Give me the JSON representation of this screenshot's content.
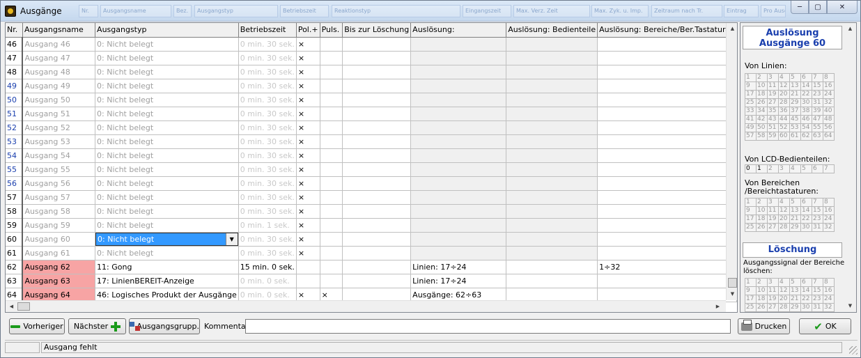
{
  "window": {
    "title": "Ausgänge",
    "ghost_toolbar": [
      "Nr.",
      "Ausgangsname",
      "Bez.",
      "Ausgangstyp",
      "Betriebszeit",
      "Reaktionstyp",
      "Eingangszeit",
      "Max. Verz. Zeit",
      "Max. Zyk. u. Imp.",
      "Zeitraum nach Tr.",
      "Eintrag",
      "Pro Ausgang"
    ]
  },
  "grid": {
    "columns": [
      "Nr.",
      "Ausgangsname",
      "Ausgangstyp",
      "Betriebszeit",
      "Pol.+",
      "Puls.",
      "Bis zur Löschung",
      "Auslösung:",
      "Auslösung: Bedienteile",
      "Auslösung: Bereiche/Ber.Tastaturen"
    ],
    "rows": [
      {
        "nr": "46",
        "name": "Ausgang 46",
        "type": "0: Nicht belegt",
        "time": "0 min. 30 sek.",
        "pol": "×",
        "puls": "",
        "bis": "",
        "ausl": "",
        "bed": "",
        "ber": ""
      },
      {
        "nr": "47",
        "name": "Ausgang 47",
        "type": "0: Nicht belegt",
        "time": "0 min. 30 sek.",
        "pol": "×",
        "puls": "",
        "bis": "",
        "ausl": "",
        "bed": "",
        "ber": ""
      },
      {
        "nr": "48",
        "name": "Ausgang 48",
        "type": "0: Nicht belegt",
        "time": "0 min. 30 sek.",
        "pol": "×",
        "puls": "",
        "bis": "",
        "ausl": "",
        "bed": "",
        "ber": ""
      },
      {
        "nr": "49",
        "name": "Ausgang 49",
        "type": "0: Nicht belegt",
        "time": "0 min. 30 sek.",
        "pol": "×",
        "puls": "",
        "bis": "",
        "ausl": "",
        "bed": "",
        "ber": ""
      },
      {
        "nr": "50",
        "name": "Ausgang 50",
        "type": "0: Nicht belegt",
        "time": "0 min. 30 sek.",
        "pol": "×",
        "puls": "",
        "bis": "",
        "ausl": "",
        "bed": "",
        "ber": ""
      },
      {
        "nr": "51",
        "name": "Ausgang 51",
        "type": "0: Nicht belegt",
        "time": "0 min. 30 sek.",
        "pol": "×",
        "puls": "",
        "bis": "",
        "ausl": "",
        "bed": "",
        "ber": ""
      },
      {
        "nr": "52",
        "name": "Ausgang 52",
        "type": "0: Nicht belegt",
        "time": "0 min. 30 sek.",
        "pol": "×",
        "puls": "",
        "bis": "",
        "ausl": "",
        "bed": "",
        "ber": ""
      },
      {
        "nr": "53",
        "name": "Ausgang 53",
        "type": "0: Nicht belegt",
        "time": "0 min. 30 sek.",
        "pol": "×",
        "puls": "",
        "bis": "",
        "ausl": "",
        "bed": "",
        "ber": ""
      },
      {
        "nr": "54",
        "name": "Ausgang 54",
        "type": "0: Nicht belegt",
        "time": "0 min. 30 sek.",
        "pol": "×",
        "puls": "",
        "bis": "",
        "ausl": "",
        "bed": "",
        "ber": ""
      },
      {
        "nr": "55",
        "name": "Ausgang 55",
        "type": "0: Nicht belegt",
        "time": "0 min. 30 sek.",
        "pol": "×",
        "puls": "",
        "bis": "",
        "ausl": "",
        "bed": "",
        "ber": ""
      },
      {
        "nr": "56",
        "name": "Ausgang 56",
        "type": "0: Nicht belegt",
        "time": "0 min. 30 sek.",
        "pol": "×",
        "puls": "",
        "bis": "",
        "ausl": "",
        "bed": "",
        "ber": ""
      },
      {
        "nr": "57",
        "name": "Ausgang 57",
        "type": "0: Nicht belegt",
        "time": "0 min. 30 sek.",
        "pol": "×",
        "puls": "",
        "bis": "",
        "ausl": "",
        "bed": "",
        "ber": ""
      },
      {
        "nr": "58",
        "name": "Ausgang 58",
        "type": "0: Nicht belegt",
        "time": "0 min. 30 sek.",
        "pol": "×",
        "puls": "",
        "bis": "",
        "ausl": "",
        "bed": "",
        "ber": ""
      },
      {
        "nr": "59",
        "name": "Ausgang 59",
        "type": "0: Nicht belegt",
        "time": "0 min. 1 sek.",
        "pol": "×",
        "puls": "",
        "bis": "",
        "ausl": "",
        "bed": "",
        "ber": ""
      },
      {
        "nr": "60",
        "name": "Ausgang 60",
        "type": "0: Nicht belegt",
        "time": "0 min. 30 sek.",
        "pol": "×",
        "puls": "",
        "bis": "",
        "ausl": "",
        "bed": "",
        "ber": ""
      },
      {
        "nr": "61",
        "name": "Ausgang 61",
        "type": "0: Nicht belegt",
        "time": "0 min. 30 sek.",
        "pol": "×",
        "puls": "",
        "bis": "",
        "ausl": "",
        "bed": "",
        "ber": ""
      },
      {
        "nr": "62",
        "name": "Ausgang 62",
        "type": "11: Gong",
        "time": "15 min. 0 sek.",
        "pol": "",
        "puls": "",
        "bis": "",
        "ausl": "Linien: 17÷24",
        "bed": "",
        "ber": "1÷32"
      },
      {
        "nr": "63",
        "name": "Ausgang 63",
        "type": "17: LinienBEREIT-Anzeige",
        "time": "0 min. 0 sek.",
        "pol": "",
        "puls": "",
        "bis": "",
        "ausl": "Linien: 17÷24",
        "bed": "",
        "ber": ""
      },
      {
        "nr": "64",
        "name": "Ausgang 64",
        "type": "46: Logisches Produkt der Ausgänge",
        "time": "0 min. 0 sek.",
        "pol": "×",
        "puls": "×",
        "bis": "",
        "ausl": "Ausgänge: 62÷63",
        "bed": "",
        "ber": ""
      }
    ]
  },
  "panel": {
    "trigger_title_1": "Auslösung",
    "trigger_title_2": "Ausgänge 60",
    "von_linien": "Von Linien:",
    "von_lcd": "Von LCD-Bedienteilen:",
    "von_bereichen_1": "Von Bereichen",
    "von_bereichen_2": "/Bereichtastaturen:",
    "loeschung_title": "Löschung",
    "loeschung_text_1": "Ausgangssignal der Bereiche",
    "loeschung_text_2": "löschen:"
  },
  "buttons": {
    "prev": "Vorheriger",
    "next": "Nächster",
    "groups": "Ausgangsgrupp.",
    "comment_label": "Kommentar:",
    "comment_value": "",
    "print": "Drucken",
    "ok": "OK"
  },
  "status": {
    "message": "Ausgang fehlt"
  },
  "colors": {
    "accent_blue": "#1a3fae",
    "selection": "#3399ff",
    "error_red": "#f7a4a4",
    "ok_green": "#1a9a1a"
  }
}
